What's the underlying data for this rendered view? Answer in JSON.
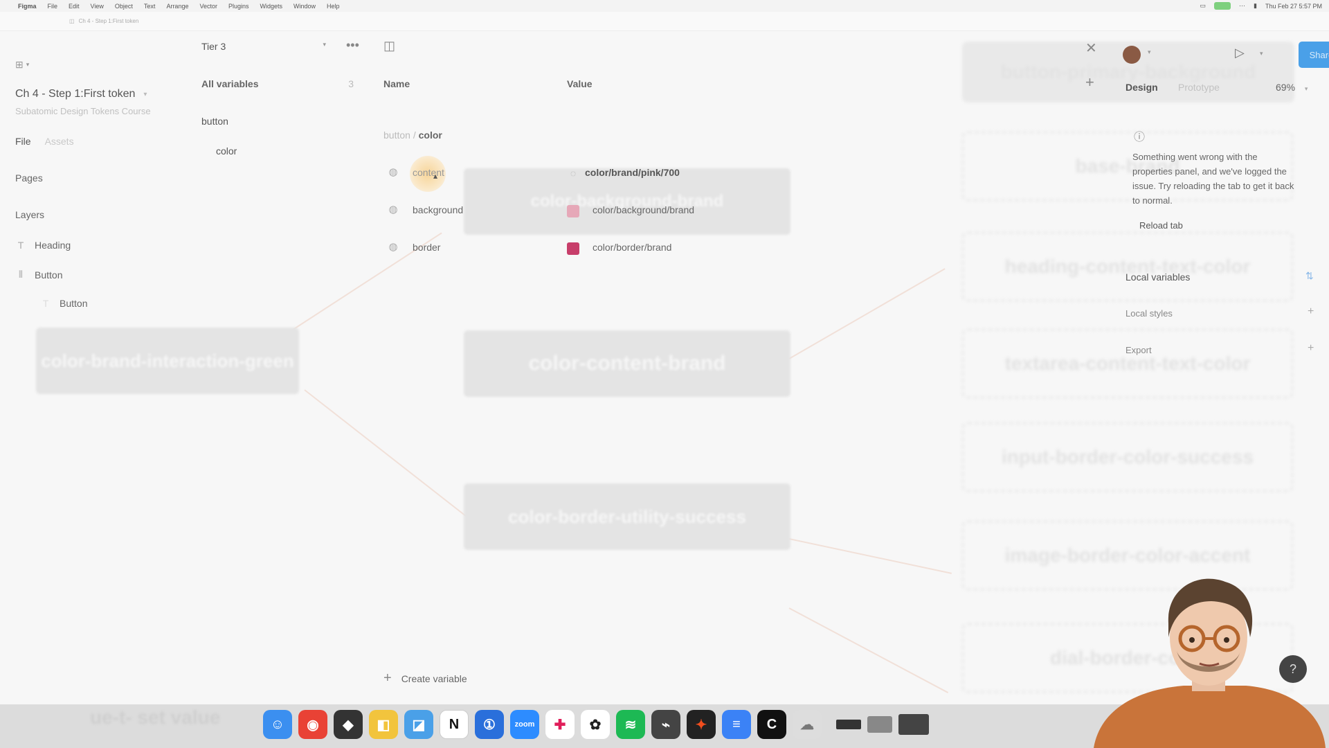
{
  "menubar": {
    "items": [
      "Figma",
      "File",
      "Edit",
      "View",
      "Object",
      "Text",
      "Arrange",
      "Vector",
      "Plugins",
      "Widgets",
      "Window",
      "Help"
    ],
    "clock": "Thu Feb 27  5:57 PM"
  },
  "tab": {
    "title": "Ch 4 - Step 1:First token"
  },
  "left_panel": {
    "file_title": "Ch 4 - Step 1:First token",
    "file_subtitle": "Subatomic Design Tokens Course",
    "tabs": {
      "file": "File",
      "assets": "Assets"
    },
    "pages_label": "Pages",
    "layers_label": "Layers",
    "layers": [
      {
        "icon": "text-icon",
        "label": "Heading"
      },
      {
        "icon": "frame-icon",
        "label": "Button"
      },
      {
        "icon": "text-icon",
        "label": "Button"
      }
    ]
  },
  "variables": {
    "collection": "Tier 3",
    "all_variables_label": "All variables",
    "all_variables_count": "3",
    "groups": [
      {
        "label": "button"
      },
      {
        "label": "color"
      }
    ],
    "name_header": "Name",
    "value_header": "Value",
    "breadcrumb_parent": "button",
    "breadcrumb_sep": "/",
    "breadcrumb_current": "color",
    "rows": [
      {
        "name": "content",
        "value": "color/brand/pink/700",
        "swatch": "#f0f0f0"
      },
      {
        "name": "background",
        "value": "color/background/brand",
        "swatch": "#e6a8b8"
      },
      {
        "name": "border",
        "value": "color/border/brand",
        "swatch": "#c73e6a"
      }
    ],
    "create_label": "Create variable"
  },
  "canvas": {
    "ghost_labels": [
      "color-brand-interaction-green",
      "color-content-brand",
      "color-border-utility-success",
      "color-background-brand"
    ],
    "right_ghosts": [
      "button-primary-background",
      "base-brand",
      "heading-content-text-color",
      "textarea-content-text-color",
      "input-border-color-success",
      "image-border-color-accent",
      "dial-border-color"
    ],
    "bottom_ghost": "ue-t- set value"
  },
  "right_panel": {
    "tabs": {
      "design": "Design",
      "prototype": "Prototype"
    },
    "zoom": "69%",
    "share_label": "Share",
    "error_message": "Something went wrong with the properties panel, and we've logged the issue. Try reloading the tab to get it back to normal.",
    "reload_label": "Reload tab",
    "local_variables": "Local variables",
    "local_styles": "Local styles",
    "export_label": "Export"
  },
  "dock": {
    "apps": [
      {
        "name": "finder",
        "color": "#3b8ff0",
        "glyph": "☺"
      },
      {
        "name": "chrome",
        "color": "#e94235",
        "glyph": "◉"
      },
      {
        "name": "app",
        "color": "#333333",
        "glyph": "◆"
      },
      {
        "name": "app2",
        "color": "#f2c43d",
        "glyph": "◧"
      },
      {
        "name": "app3",
        "color": "#4aa0e8",
        "glyph": "◪"
      },
      {
        "name": "notion",
        "color": "#ffffff",
        "glyph": "N"
      },
      {
        "name": "1password",
        "color": "#2a6fdb",
        "glyph": "①"
      },
      {
        "name": "zoom",
        "color": "#2d8cff",
        "glyph": "zoom"
      },
      {
        "name": "slack",
        "color": "#ffffff",
        "glyph": "✚"
      },
      {
        "name": "chatgpt",
        "color": "#ffffff",
        "glyph": "✿"
      },
      {
        "name": "spotify",
        "color": "#1db954",
        "glyph": "≋"
      },
      {
        "name": "app4",
        "color": "#444444",
        "glyph": "⌁"
      },
      {
        "name": "figma",
        "color": "#222222",
        "glyph": "✦"
      },
      {
        "name": "docs",
        "color": "#3b82f6",
        "glyph": "≡"
      },
      {
        "name": "capcut",
        "color": "#111111",
        "glyph": "C"
      },
      {
        "name": "app5",
        "color": "#dddddd",
        "glyph": "☁"
      }
    ]
  },
  "help_label": "?"
}
